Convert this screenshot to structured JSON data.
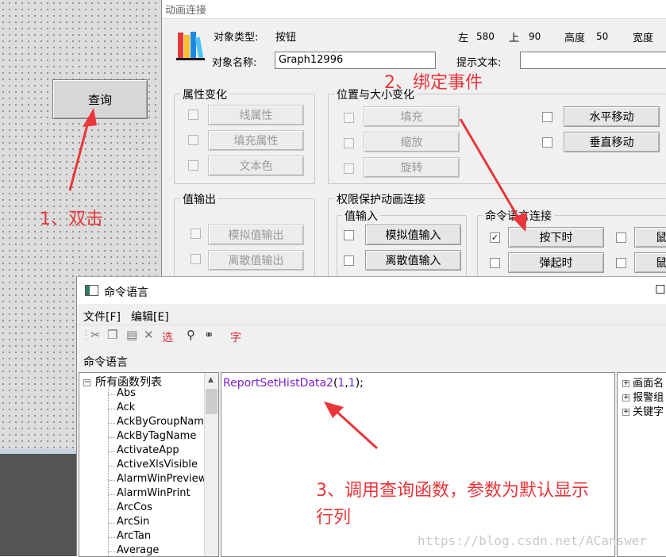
{
  "canvas": {
    "button_label": "查询"
  },
  "anim_dialog": {
    "title": "动画连接",
    "object_type_label": "对象类型:",
    "object_type_value": "按钮",
    "left_label": "左",
    "left_value": "580",
    "top_label": "上",
    "top_value": "90",
    "height_label": "高度",
    "height_value": "50",
    "width_label": "宽度",
    "object_name_label": "对象名称:",
    "object_name_value": "Graph12996",
    "tooltip_label": "提示文本:",
    "tooltip_value": "",
    "groups": {
      "attr_change": {
        "title": "属性变化",
        "buttons": [
          "线属性",
          "填充属性",
          "文本色"
        ]
      },
      "pos_size": {
        "title": "位置与大小变化",
        "buttons": [
          "填充",
          "缩放",
          "旋转"
        ],
        "move_buttons": [
          "水平移动",
          "垂直移动"
        ]
      },
      "value_output": {
        "title": "值输出",
        "buttons": [
          "模拟值输出",
          "离散值输出"
        ]
      },
      "permission": {
        "title": "权限保护动画连接"
      },
      "value_input": {
        "title": "值输入",
        "buttons": [
          "模拟值输入",
          "离散值输入"
        ]
      },
      "command": {
        "title": "命令语言连接",
        "buttons": [
          "按下时",
          "弹起时"
        ],
        "checked": [
          true,
          false
        ],
        "right_partial": [
          "鼠",
          "鼠"
        ]
      }
    }
  },
  "cmd_dialog": {
    "title": "命令语言",
    "close_glyph": "☐",
    "menu": [
      "文件[F]",
      "编辑[E]"
    ],
    "toolbar_select_label": "选",
    "toolbar_font_label": "字",
    "section_label": "命令语言",
    "tree_root": "所有函数列表",
    "functions": [
      "Abs",
      "Ack",
      "AckByGroupName",
      "AckByTagName",
      "ActivateApp",
      "ActiveXlsVisible",
      "AlarmWinPreview",
      "AlarmWinPrint",
      "ArcCos",
      "ArcSin",
      "ArcTan",
      "Average"
    ],
    "code": {
      "func": "ReportSetHistData2",
      "open": "(",
      "arg1": "1",
      "comma": ",",
      "arg2": "1",
      "close": ");"
    },
    "right_tree": [
      "画面名",
      "报警组",
      "关键字"
    ]
  },
  "annotations": {
    "step1": "1、双击",
    "step2": "2、绑定事件",
    "step3_line1": "3、调用查询函数，参数为默认显示",
    "step3_line2": "行列",
    "watermark": "https://blog.csdn.net/ACanswer"
  },
  "colors": {
    "annotation": "#e8363a",
    "code_func": "#7b1fd0",
    "code_num": "#6d2bd6"
  }
}
